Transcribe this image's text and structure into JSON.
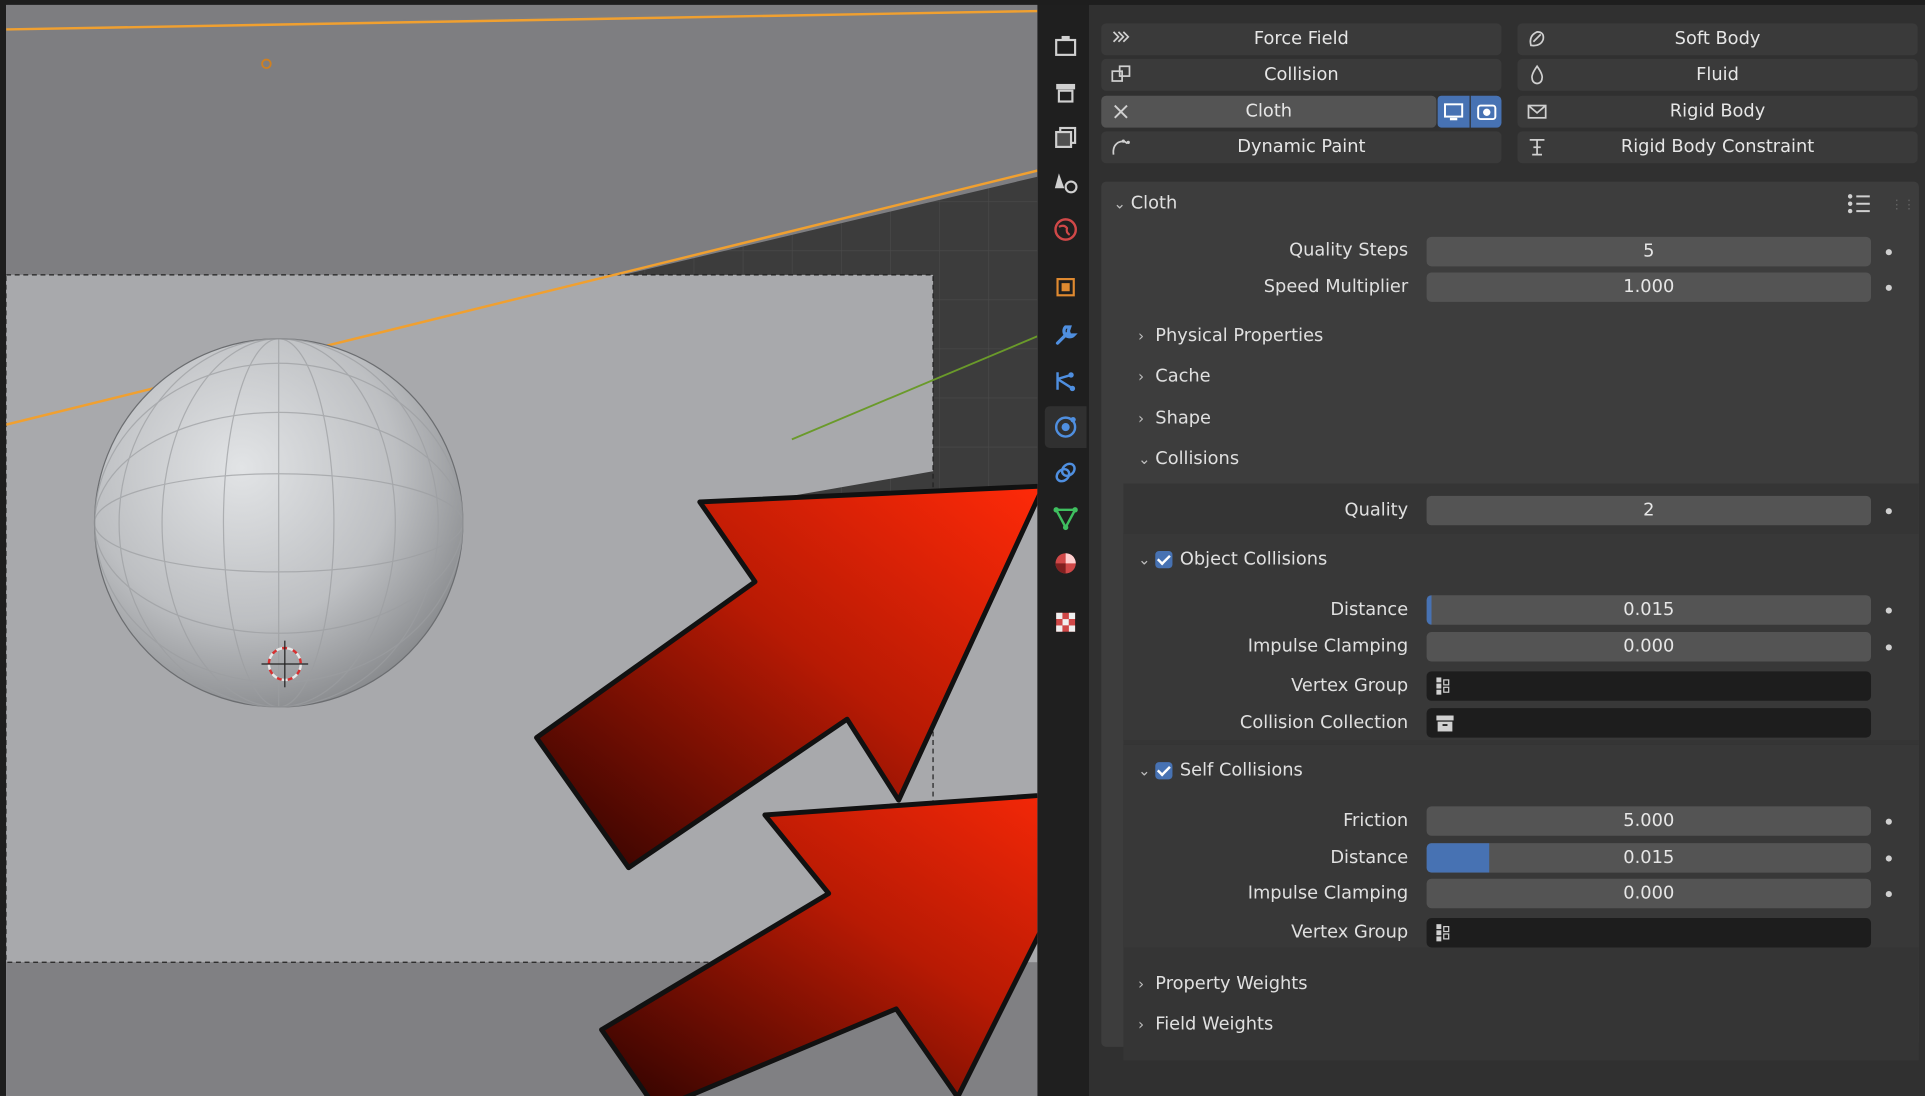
{
  "physics_buttons": {
    "force_field": "Force Field",
    "soft_body": "Soft Body",
    "collision": "Collision",
    "fluid": "Fluid",
    "cloth": "Cloth",
    "rigid_body": "Rigid Body",
    "dynamic_paint": "Dynamic Paint",
    "rigid_body_constraint": "Rigid Body Constraint"
  },
  "cloth_panel": {
    "title": "Cloth",
    "quality_steps": {
      "label": "Quality Steps",
      "value": "5"
    },
    "speed_multiplier": {
      "label": "Speed Multiplier",
      "value": "1.000"
    },
    "subpanels": {
      "physical_properties": "Physical Properties",
      "cache": "Cache",
      "shape": "Shape",
      "collisions": "Collisions",
      "property_weights": "Property Weights",
      "field_weights": "Field Weights"
    },
    "collisions": {
      "quality": {
        "label": "Quality",
        "value": "2"
      },
      "object_collisions": {
        "title": "Object Collisions",
        "enabled": true,
        "distance": {
          "label": "Distance",
          "value": "0.015",
          "fill_fraction": 0.01
        },
        "impulse_clamping": {
          "label": "Impulse Clamping",
          "value": "0.000"
        },
        "vertex_group": {
          "label": "Vertex Group",
          "value": ""
        },
        "collision_collection": {
          "label": "Collision Collection",
          "value": ""
        }
      },
      "self_collisions": {
        "title": "Self Collisions",
        "enabled": true,
        "friction": {
          "label": "Friction",
          "value": "5.000"
        },
        "distance": {
          "label": "Distance",
          "value": "0.015",
          "fill_fraction": 0.14
        },
        "impulse_clamping": {
          "label": "Impulse Clamping",
          "value": "0.000"
        },
        "vertex_group": {
          "label": "Vertex Group",
          "value": ""
        }
      }
    }
  },
  "property_tabs": [
    "tool-icon",
    "render-icon",
    "output-icon",
    "view-layer-icon",
    "scene-icon",
    "world-icon",
    "object-icon",
    "modifier-icon",
    "particles-icon",
    "physics-icon",
    "constraints-icon",
    "data-icon",
    "material-icon",
    "texture-icon"
  ],
  "active_tab": "physics-icon",
  "colors": {
    "accent": "#4772b3",
    "arrow_red": "#e82a08",
    "selection_orange": "#f0a030"
  }
}
